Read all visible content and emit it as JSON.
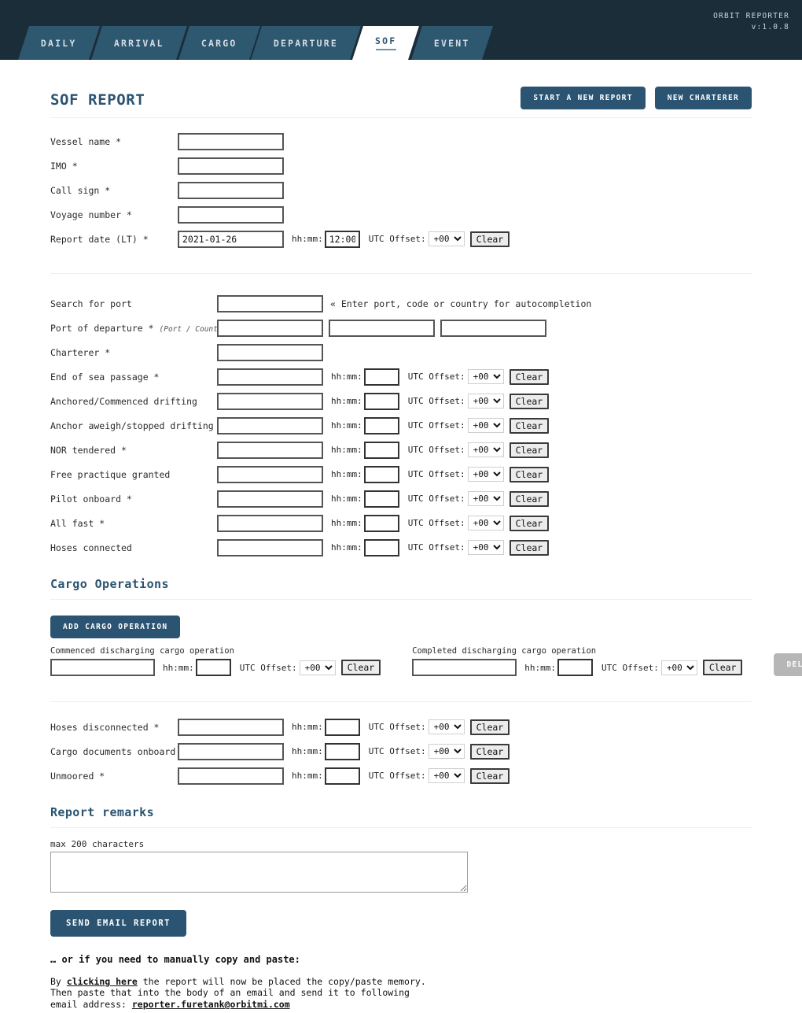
{
  "header": {
    "brand_name": "ORBIT REPORTER",
    "version": "v:1.0.8",
    "tabs": [
      {
        "label": "DAILY",
        "active": false
      },
      {
        "label": "ARRIVAL",
        "active": false
      },
      {
        "label": "CARGO",
        "active": false
      },
      {
        "label": "DEPARTURE",
        "active": false
      },
      {
        "label": "SOF",
        "active": true
      },
      {
        "label": "EVENT",
        "active": false
      }
    ]
  },
  "page": {
    "title": "SOF REPORT",
    "actions": {
      "start_new_report": "START A NEW REPORT",
      "new_charterer": "NEW CHARTERER"
    }
  },
  "labels": {
    "hhmm": "hh:mm:",
    "utc_offset": "UTC Offset:",
    "clear": "Clear",
    "utc_value": "+00"
  },
  "vessel_section": [
    {
      "label": "Vessel name *",
      "value": "",
      "type": "text"
    },
    {
      "label": "IMO *",
      "value": "",
      "type": "text"
    },
    {
      "label": "Call sign *",
      "value": "",
      "type": "text"
    },
    {
      "label": "Voyage number *",
      "value": "",
      "type": "text"
    },
    {
      "label": "Report date (LT) *",
      "value": "2021-01-26",
      "time": "12:00",
      "type": "datetime"
    }
  ],
  "port_section": {
    "search_label": "Search for port",
    "search_value": "",
    "search_note": "« Enter port, code or country for autocompletion",
    "departure_label": "Port of departure *",
    "departure_hint": "(Port / Country / Code)",
    "departure_values": [
      "",
      "",
      ""
    ],
    "charterer_label": "Charterer *",
    "charterer_value": ""
  },
  "event_rows": [
    {
      "label": "End of sea passage *",
      "value": "",
      "time": ""
    },
    {
      "label": "Anchored/Commenced drifting",
      "value": "",
      "time": ""
    },
    {
      "label": "Anchor aweigh/stopped drifting",
      "value": "",
      "time": ""
    },
    {
      "label": "NOR tendered *",
      "value": "",
      "time": ""
    },
    {
      "label": "Free practique granted",
      "value": "",
      "time": ""
    },
    {
      "label": "Pilot onboard *",
      "value": "",
      "time": ""
    },
    {
      "label": "All fast *",
      "value": "",
      "time": ""
    },
    {
      "label": "Hoses connected",
      "value": "",
      "time": ""
    }
  ],
  "cargo": {
    "title": "Cargo Operations",
    "add_button": "ADD CARGO OPERATION",
    "delete_button": "DELETE ROW",
    "rows": [
      {
        "commenced_label": "Commenced discharging cargo operation",
        "commenced_value": "",
        "commenced_time": "",
        "completed_label": "Completed discharging cargo operation",
        "completed_value": "",
        "completed_time": ""
      }
    ]
  },
  "final_rows": [
    {
      "label": "Hoses disconnected *",
      "value": "",
      "time": ""
    },
    {
      "label": "Cargo documents onboard *",
      "value": "",
      "time": ""
    },
    {
      "label": "Unmoored *",
      "value": "",
      "time": ""
    }
  ],
  "remarks": {
    "title": "Report remarks",
    "note": "max 200 characters",
    "value": ""
  },
  "send": {
    "button": "SEND EMAIL REPORT",
    "manual_heading": "… or if you need to manually copy and paste:",
    "manual_prefix": "By ",
    "manual_link": "clicking here",
    "manual_mid": " the report will now be placed the copy/paste memory.",
    "manual_line2": "Then paste that into the body of an email and send it to following",
    "manual_line3_prefix": "email address: ",
    "manual_email": "reporter.furetank@orbitmi.com"
  }
}
